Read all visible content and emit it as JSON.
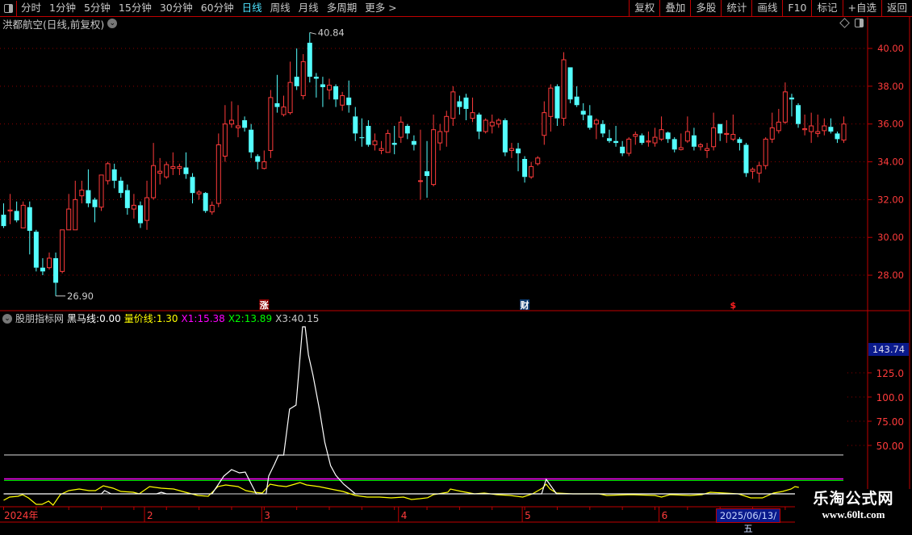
{
  "toolbar": {
    "periods": [
      "分时",
      "1分钟",
      "5分钟",
      "15分钟",
      "30分钟",
      "60分钟",
      "日线",
      "周线",
      "月线",
      "多周期",
      "更多 >"
    ],
    "active_period": "日线",
    "buttons": [
      "复权",
      "叠加",
      "多股",
      "统计",
      "画线",
      "F10",
      "标记",
      "+自选",
      "返回"
    ]
  },
  "main": {
    "title": "洪都航空(日线,前复权)",
    "price_axis": [
      "40.00",
      "38.00",
      "36.00",
      "34.00",
      "32.00",
      "30.00",
      "28.00"
    ],
    "price_axis_values": [
      40,
      38,
      36,
      34,
      32,
      30,
      28
    ],
    "high_label": "40.84",
    "low_label": "26.90",
    "markers": [
      {
        "text": "涨",
        "index": 40
      },
      {
        "text": "财",
        "index": 80
      },
      {
        "text": "$",
        "index": 112
      }
    ],
    "colors": {
      "up": "#ff3b3b",
      "down": "#54ffff",
      "grid": "#8b0000",
      "frame": "#c00000"
    },
    "candles": [
      [
        31.2,
        31.8,
        30.5,
        30.6
      ],
      [
        31.4,
        32.3,
        30.7,
        31.45
      ],
      [
        31.4,
        31.9,
        30.8,
        30.9
      ],
      [
        30.5,
        31.9,
        30.5,
        31.7
      ],
      [
        31.6,
        31.9,
        29.1,
        30.35
      ],
      [
        30.3,
        30.4,
        28.2,
        28.4
      ],
      [
        28.4,
        28.9,
        28.0,
        28.2
      ],
      [
        28.4,
        29.2,
        28.3,
        28.9
      ],
      [
        28.9,
        29.2,
        26.9,
        27.6
      ],
      [
        28.2,
        30.4,
        28.1,
        30.4
      ],
      [
        30.4,
        32.3,
        30.4,
        31.5
      ],
      [
        30.4,
        33.0,
        30.4,
        32.0
      ],
      [
        32.2,
        33.0,
        31.8,
        32.5
      ],
      [
        32.5,
        33.6,
        31.6,
        31.8
      ],
      [
        32.0,
        32.1,
        30.8,
        31.6
      ],
      [
        31.6,
        33.3,
        31.4,
        33.3
      ],
      [
        33.0,
        34.0,
        32.8,
        33.9
      ],
      [
        33.6,
        33.9,
        32.6,
        33.0
      ],
      [
        33.0,
        33.2,
        32.1,
        32.35
      ],
      [
        32.5,
        32.8,
        31.2,
        31.55
      ],
      [
        31.5,
        32.3,
        31.0,
        31.7
      ],
      [
        31.7,
        31.9,
        30.5,
        30.75
      ],
      [
        30.9,
        33.0,
        30.4,
        32.1
      ],
      [
        32.1,
        35.0,
        32.0,
        33.8
      ],
      [
        33.4,
        34.2,
        32.8,
        33.5
      ],
      [
        33.2,
        34.0,
        33.1,
        33.85
      ],
      [
        33.65,
        34.5,
        33.3,
        33.75
      ],
      [
        33.65,
        33.9,
        33.3,
        33.75
      ],
      [
        33.7,
        34.5,
        33.1,
        33.35
      ],
      [
        33.2,
        33.4,
        31.8,
        32.35
      ],
      [
        32.3,
        32.5,
        32.0,
        32.4
      ],
      [
        32.35,
        32.4,
        31.3,
        31.4
      ],
      [
        31.35,
        31.9,
        31.2,
        31.7
      ],
      [
        31.8,
        35.5,
        31.6,
        34.9
      ],
      [
        34.3,
        37.0,
        34.0,
        36.0
      ],
      [
        36.0,
        37.2,
        35.8,
        36.2
      ],
      [
        35.8,
        37.0,
        35.3,
        35.9
      ],
      [
        36.2,
        36.4,
        35.6,
        35.8
      ],
      [
        35.7,
        36.0,
        34.2,
        34.5
      ],
      [
        34.3,
        34.4,
        33.6,
        34.0
      ],
      [
        33.65,
        34.6,
        33.6,
        34.0
      ],
      [
        34.6,
        37.8,
        34.2,
        37.4
      ],
      [
        37.1,
        38.6,
        36.6,
        36.9
      ],
      [
        36.5,
        37.5,
        36.4,
        36.9
      ],
      [
        36.6,
        39.3,
        36.5,
        38.2
      ],
      [
        38.5,
        40.0,
        37.8,
        38.0
      ],
      [
        37.5,
        39.7,
        37.3,
        39.3
      ],
      [
        40.3,
        40.84,
        38.2,
        38.5
      ],
      [
        38.5,
        38.7,
        37.4,
        38.4
      ],
      [
        38.1,
        38.5,
        36.9,
        37.95
      ],
      [
        37.8,
        38.4,
        37.3,
        38.05
      ],
      [
        38.0,
        38.1,
        36.9,
        37.3
      ],
      [
        37.0,
        37.7,
        36.7,
        37.5
      ],
      [
        37.4,
        38.3,
        36.6,
        37.0
      ],
      [
        36.4,
        36.9,
        35.1,
        35.5
      ],
      [
        35.3,
        36.3,
        34.8,
        35.25
      ],
      [
        35.9,
        36.2,
        34.8,
        34.9
      ],
      [
        34.9,
        35.5,
        34.6,
        35.1
      ],
      [
        34.6,
        35.1,
        34.4,
        34.7
      ],
      [
        34.5,
        35.7,
        34.5,
        35.5
      ],
      [
        35.0,
        35.9,
        34.4,
        34.9
      ],
      [
        35.3,
        36.4,
        35.0,
        36.1
      ],
      [
        35.9,
        36.0,
        35.2,
        35.5
      ],
      [
        35.1,
        35.4,
        34.6,
        34.9
      ],
      [
        33.0,
        35.7,
        32.0,
        33.0
      ],
      [
        33.5,
        35.1,
        32.1,
        33.25
      ],
      [
        32.8,
        36.5,
        32.7,
        35.7
      ],
      [
        35.0,
        36.0,
        34.6,
        35.6
      ],
      [
        35.6,
        36.7,
        34.8,
        36.4
      ],
      [
        36.3,
        38.0,
        35.9,
        37.7
      ],
      [
        37.2,
        37.5,
        36.5,
        36.9
      ],
      [
        37.4,
        37.6,
        36.2,
        36.8
      ],
      [
        36.3,
        37.4,
        36.1,
        36.6
      ],
      [
        36.5,
        36.6,
        35.2,
        35.6
      ],
      [
        35.6,
        36.3,
        35.5,
        36.2
      ],
      [
        35.9,
        36.5,
        35.5,
        36.1
      ],
      [
        36.0,
        36.3,
        35.8,
        36.2
      ],
      [
        36.2,
        36.3,
        34.3,
        34.5
      ],
      [
        34.6,
        35.0,
        34.2,
        34.7
      ],
      [
        34.7,
        35.0,
        33.5,
        34.45
      ],
      [
        34.15,
        34.3,
        32.9,
        33.2
      ],
      [
        33.2,
        34.0,
        33.1,
        33.75
      ],
      [
        33.9,
        34.3,
        33.8,
        34.2
      ],
      [
        35.4,
        37.2,
        34.9,
        36.6
      ],
      [
        36.4,
        38.1,
        35.6,
        37.9
      ],
      [
        38.0,
        38.1,
        35.9,
        36.3
      ],
      [
        36.3,
        39.8,
        35.9,
        39.4
      ],
      [
        39.0,
        39.0,
        37.1,
        37.3
      ],
      [
        37.45,
        38.0,
        36.9,
        37.0
      ],
      [
        36.7,
        37.1,
        36.2,
        36.5
      ],
      [
        36.45,
        37.0,
        35.7,
        35.8
      ],
      [
        36.0,
        36.3,
        35.2,
        36.2
      ],
      [
        36.0,
        36.2,
        35.3,
        35.5
      ],
      [
        35.25,
        35.7,
        35.0,
        35.1
      ],
      [
        35.1,
        35.9,
        34.8,
        35.0
      ],
      [
        34.8,
        35.1,
        34.3,
        34.45
      ],
      [
        34.45,
        35.3,
        34.3,
        35.2
      ],
      [
        35.35,
        35.6,
        34.9,
        35.45
      ],
      [
        35.4,
        35.5,
        34.9,
        35.0
      ],
      [
        35.05,
        35.6,
        34.8,
        35.1
      ],
      [
        35.0,
        35.8,
        34.8,
        35.3
      ],
      [
        35.2,
        36.4,
        35.1,
        35.7
      ],
      [
        35.55,
        35.6,
        35.0,
        35.2
      ],
      [
        35.2,
        35.3,
        34.5,
        34.65
      ],
      [
        34.65,
        35.5,
        34.6,
        34.75
      ],
      [
        35.1,
        36.4,
        35.0,
        35.6
      ],
      [
        35.4,
        35.8,
        34.6,
        34.8
      ],
      [
        34.8,
        35.0,
        34.6,
        34.9
      ],
      [
        34.6,
        35.0,
        34.2,
        34.7
      ],
      [
        34.8,
        36.6,
        34.6,
        35.8
      ],
      [
        36.0,
        36.0,
        35.1,
        35.5
      ],
      [
        35.45,
        36.2,
        35.0,
        35.5
      ],
      [
        35.2,
        36.5,
        35.1,
        35.45
      ],
      [
        35.2,
        35.3,
        34.6,
        35.0
      ],
      [
        34.9,
        35.0,
        33.2,
        33.4
      ],
      [
        33.5,
        33.7,
        33.1,
        33.6
      ],
      [
        33.4,
        34.0,
        32.9,
        33.8
      ],
      [
        33.8,
        35.3,
        33.6,
        35.2
      ],
      [
        35.2,
        36.6,
        35.0,
        35.8
      ],
      [
        35.65,
        36.8,
        35.5,
        36.1
      ],
      [
        36.1,
        38.2,
        36.0,
        37.7
      ],
      [
        37.4,
        37.6,
        36.4,
        37.3
      ],
      [
        37.0,
        37.1,
        35.8,
        36.0
      ],
      [
        35.7,
        36.5,
        35.4,
        35.75
      ],
      [
        35.6,
        36.6,
        35.0,
        35.9
      ],
      [
        35.5,
        36.5,
        35.3,
        35.6
      ],
      [
        35.65,
        36.3,
        35.4,
        35.9
      ],
      [
        35.85,
        36.3,
        35.5,
        35.6
      ],
      [
        35.5,
        35.6,
        35.0,
        35.2
      ],
      [
        35.15,
        36.4,
        35.0,
        36.0
      ]
    ]
  },
  "indicator": {
    "name": "股朋指标网",
    "heima_label": "黑马线:",
    "heima_value": "0.00",
    "liangjia_label": "量价线:",
    "liangjia_value": "1.30",
    "x1_label": "X1:",
    "x1_value": "15.38",
    "x2_label": "X2:",
    "x2_value": "13.89",
    "x3_label": "X3:",
    "x3_value": "40.15",
    "x1": 15.38,
    "x2": 13.89,
    "x3": 40.15,
    "axis_labels": [
      "125.0",
      "100.0",
      "75.00",
      "50.00"
    ],
    "axis_values": [
      125,
      100,
      75,
      50
    ],
    "max_label": "143.74",
    "colors": {
      "heima": "#ffffff",
      "liangjia": "#ffff00",
      "x1": "#ff00ff",
      "x2": "#00ff00",
      "x3": "#ffffff",
      "axis": "#ff3b3b"
    },
    "heima_series": [
      [
        0,
        0
      ],
      [
        15,
        0
      ],
      [
        15.5,
        3.3
      ],
      [
        16.5,
        0
      ],
      [
        23.5,
        0
      ],
      [
        24.2,
        1.7
      ],
      [
        25,
        0
      ],
      [
        32,
        0
      ],
      [
        33.8,
        18.3
      ],
      [
        35,
        25
      ],
      [
        36.2,
        21.7
      ],
      [
        37.1,
        22.5
      ],
      [
        37.9,
        11.7
      ],
      [
        38.8,
        0
      ],
      [
        40.3,
        0
      ],
      [
        40.7,
        18.3
      ],
      [
        41.6,
        30.8
      ],
      [
        42.2,
        40
      ],
      [
        43,
        40
      ],
      [
        43.9,
        87.5
      ],
      [
        44.9,
        91.7
      ],
      [
        45.9,
        172.5
      ],
      [
        46.3,
        172.5
      ],
      [
        46.8,
        143.3
      ],
      [
        47.5,
        122.5
      ],
      [
        48.5,
        86.7
      ],
      [
        49.3,
        53.3
      ],
      [
        50.2,
        29.2
      ],
      [
        51,
        19.2
      ],
      [
        52.2,
        10
      ],
      [
        54,
        0
      ],
      [
        82.6,
        0
      ],
      [
        83.3,
        15
      ],
      [
        84.9,
        0
      ],
      [
        122,
        0
      ]
    ],
    "liangjia_series": [
      [
        0,
        -6.7
      ],
      [
        0.9,
        -3.3
      ],
      [
        2.2,
        -2.5
      ],
      [
        2.9,
        -0.8
      ],
      [
        3.8,
        -4.2
      ],
      [
        5,
        -10.8
      ],
      [
        5.9,
        -10.8
      ],
      [
        6.9,
        -7.5
      ],
      [
        7.6,
        -11.7
      ],
      [
        8.7,
        -0.8
      ],
      [
        10,
        3.3
      ],
      [
        11.6,
        5
      ],
      [
        13.1,
        3.3
      ],
      [
        14.1,
        3.3
      ],
      [
        15.3,
        8.3
      ],
      [
        16.8,
        5.8
      ],
      [
        18,
        2.5
      ],
      [
        19.9,
        1.7
      ],
      [
        20.8,
        0
      ],
      [
        22.4,
        7.5
      ],
      [
        24.2,
        5.8
      ],
      [
        26.1,
        5
      ],
      [
        27.9,
        1.7
      ],
      [
        29.8,
        -1.7
      ],
      [
        31.4,
        -2.5
      ],
      [
        32.9,
        7.5
      ],
      [
        34.1,
        9.2
      ],
      [
        36,
        7.5
      ],
      [
        37.2,
        3.3
      ],
      [
        38.5,
        1.7
      ],
      [
        39.7,
        0.8
      ],
      [
        40.9,
        10
      ],
      [
        42.2,
        8.3
      ],
      [
        43.4,
        7.5
      ],
      [
        44.7,
        10
      ],
      [
        45.5,
        11.7
      ],
      [
        46.5,
        9.2
      ],
      [
        48.4,
        7.5
      ],
      [
        50.2,
        5
      ],
      [
        52.1,
        2.5
      ],
      [
        54,
        -1.7
      ],
      [
        55.8,
        -3.3
      ],
      [
        57.7,
        -3.3
      ],
      [
        59.5,
        -4.2
      ],
      [
        61.4,
        -3.3
      ],
      [
        62.6,
        -5.8
      ],
      [
        63.9,
        -5
      ],
      [
        65.1,
        -4
      ],
      [
        66,
        -0.8
      ],
      [
        68.2,
        1.7
      ],
      [
        68.6,
        5
      ],
      [
        70.3,
        2.5
      ],
      [
        72.3,
        0
      ],
      [
        73.8,
        0.8
      ],
      [
        75.7,
        -0.8
      ],
      [
        77.8,
        -1.7
      ],
      [
        79.7,
        -3.3
      ],
      [
        81.2,
        0
      ],
      [
        82.7,
        5.8
      ],
      [
        83.3,
        10
      ],
      [
        83.9,
        5
      ],
      [
        84.9,
        0.8
      ],
      [
        87.4,
        0
      ],
      [
        91.4,
        0
      ],
      [
        92.6,
        -1.7
      ],
      [
        96.3,
        -0.8
      ],
      [
        100,
        -1.7
      ],
      [
        101,
        -3.3
      ],
      [
        102.3,
        -0.8
      ],
      [
        105.4,
        -1.7
      ],
      [
        107.2,
        -0.8
      ],
      [
        108.5,
        1.7
      ],
      [
        112.8,
        0
      ],
      [
        114.7,
        -4.2
      ],
      [
        116.5,
        -4.2
      ],
      [
        118.2,
        0.8
      ],
      [
        119.6,
        2.5
      ],
      [
        120.9,
        5
      ],
      [
        121.5,
        7.5
      ],
      [
        122.1,
        6.7
      ]
    ]
  },
  "time_axis": {
    "labels": [
      {
        "text": "2024年",
        "index": 0
      },
      {
        "text": "2",
        "index": 22
      },
      {
        "text": "3",
        "index": 40
      },
      {
        "text": "4",
        "index": 61
      },
      {
        "text": "5",
        "index": 80
      },
      {
        "text": "6",
        "index": 101
      }
    ],
    "current_date": "2025/06/13/五"
  },
  "watermark": {
    "title": "乐淘公式网",
    "url": "www.60lt.com"
  }
}
